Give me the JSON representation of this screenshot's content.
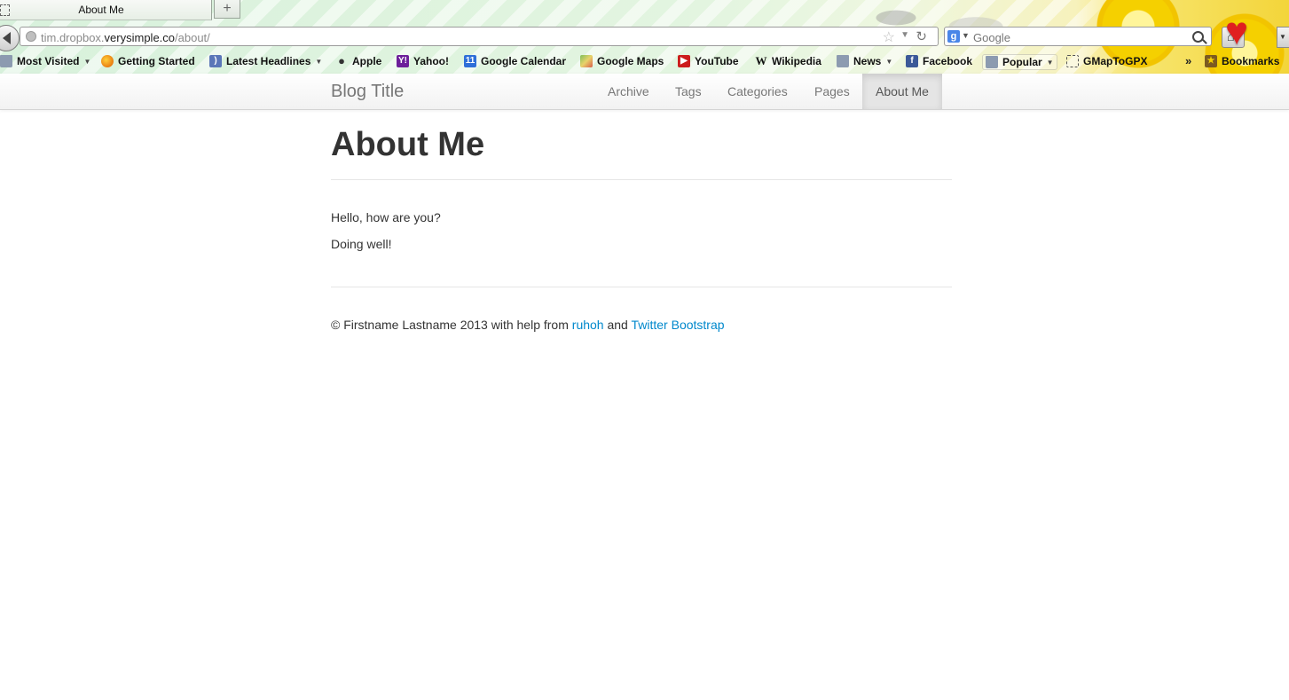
{
  "browser": {
    "tab": {
      "title": "About Me"
    },
    "new_tab_label": "+",
    "url": {
      "prefix": "tim.dropbox.",
      "domain": "verysimple.co",
      "path": "/about/"
    },
    "search": {
      "placeholder": "Google",
      "engine_letter": "g"
    },
    "bookmarks": [
      {
        "label": "Most Visited",
        "icon": "folder-icon",
        "dropdown": true
      },
      {
        "label": "Getting Started",
        "icon": "firefox-icon"
      },
      {
        "label": "Latest Headlines",
        "icon": "rss-feed-icon",
        "dropdown": true
      },
      {
        "label": "Apple",
        "icon": "apple-icon"
      },
      {
        "label": "Yahoo!",
        "icon": "yahoo-icon"
      },
      {
        "label": "Google Calendar",
        "icon": "google-calendar-icon"
      },
      {
        "label": "Google Maps",
        "icon": "google-maps-icon"
      },
      {
        "label": "YouTube",
        "icon": "youtube-icon"
      },
      {
        "label": "Wikipedia",
        "icon": "wikipedia-icon"
      },
      {
        "label": "News",
        "icon": "folder-icon",
        "dropdown": true
      },
      {
        "label": "Facebook",
        "icon": "facebook-icon"
      },
      {
        "label": "Popular",
        "icon": "folder-icon",
        "dropdown": true
      },
      {
        "label": "GMapToGPX",
        "icon": "bookmarklet-icon"
      }
    ],
    "bookmarks_menu_label": "Bookmarks",
    "overflow_chevron": "»"
  },
  "site": {
    "brand": "Blog Title",
    "nav": [
      {
        "label": "Archive",
        "active": false
      },
      {
        "label": "Tags",
        "active": false
      },
      {
        "label": "Categories",
        "active": false
      },
      {
        "label": "Pages",
        "active": false
      },
      {
        "label": "About Me",
        "active": true
      }
    ]
  },
  "content": {
    "title": "About Me",
    "paragraphs": [
      "Hello, how are you?",
      "Doing well!"
    ]
  },
  "footer": {
    "text_prefix": "© Firstname Lastname 2013 with help from",
    "link1": "ruhoh",
    "text_mid": "and",
    "link2": "Twitter Bootstrap"
  },
  "colors": {
    "link": "#0088cc",
    "heading": "#333333",
    "nav_text": "#777777",
    "nav_active_bg": "#e5e5e5"
  }
}
